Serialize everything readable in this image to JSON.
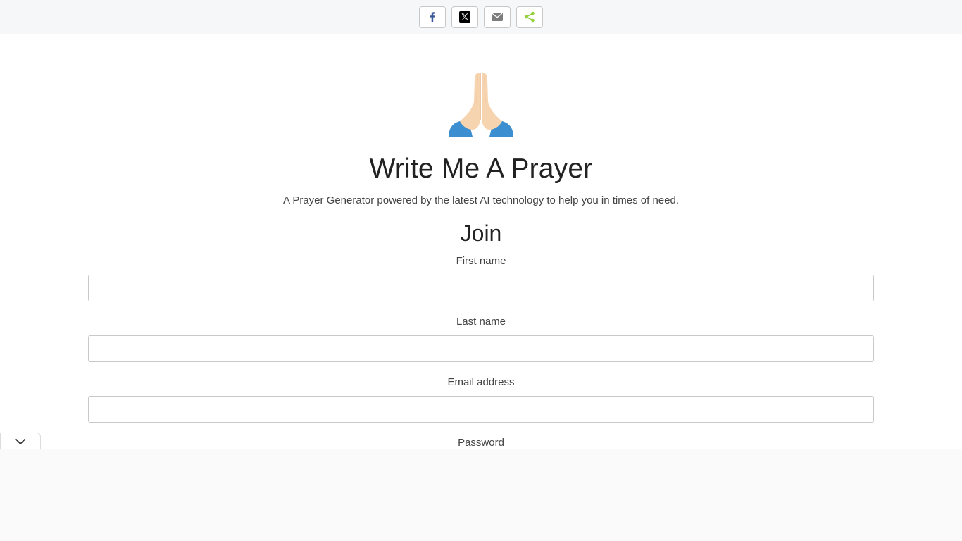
{
  "share_bar": {
    "buttons": [
      {
        "name": "facebook",
        "icon": "facebook-icon",
        "color": "#3b5998"
      },
      {
        "name": "x",
        "icon": "x-icon",
        "color": "#000000"
      },
      {
        "name": "email",
        "icon": "email-icon",
        "color": "#7d7d7d"
      },
      {
        "name": "share",
        "icon": "share-icon",
        "color": "#95d03a"
      }
    ]
  },
  "hero": {
    "emoji_icon": "folded-hands-icon",
    "title": "Write Me A Prayer",
    "subtitle": "A Prayer Generator powered by the latest AI technology to help you in times of need."
  },
  "form": {
    "heading": "Join",
    "fields": [
      {
        "label": "First name",
        "value": "",
        "placeholder": ""
      },
      {
        "label": "Last name",
        "value": "",
        "placeholder": ""
      },
      {
        "label": "Email address",
        "value": "",
        "placeholder": ""
      },
      {
        "label": "Password",
        "value": "",
        "placeholder": ""
      }
    ]
  },
  "bottom_panel": {
    "collapse_icon": "chevron-down-icon"
  }
}
